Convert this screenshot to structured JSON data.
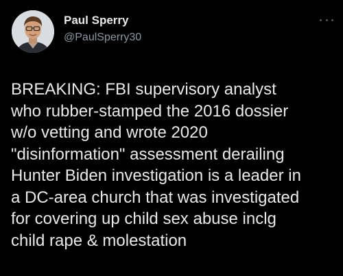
{
  "author": {
    "display_name": "Paul Sperry",
    "handle": "@PaulSperry30",
    "avatar_icon": "profile-photo"
  },
  "menu_icon": "more-horizontal-icon",
  "tweet": {
    "text": "BREAKING: FBI supervisory analyst\nwho rubber-stamped the 2016 dossier\nw/o vetting and wrote 2020\n\"disinformation\" assessment derailing\nHunter Biden investigation is a leader in\na DC-area church that was investigated\nfor covering up child sex abuse inclg\nchild rape & molestation"
  },
  "colors": {
    "background": "#000000",
    "primary_text": "#e7e9ea",
    "secondary_text": "#8b98a5"
  }
}
